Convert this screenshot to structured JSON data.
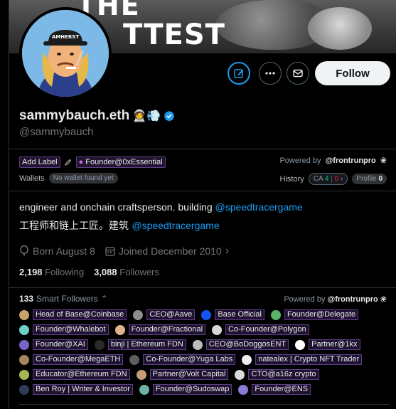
{
  "banner": {
    "text_line1": "THE",
    "text_line2": "TTEST",
    "text_line3": ""
  },
  "profile": {
    "display_name": "sammybauch.eth",
    "name_emojis": "🧑‍🚀💨",
    "handle": "@sammybauch",
    "verified": true,
    "avatar_cap_text": "AMHERST"
  },
  "actions": {
    "edit_icon": "note-edit-icon",
    "more_icon": "ellipsis-icon",
    "message_icon": "envelope-icon",
    "follow_label": "Follow"
  },
  "labels": {
    "add_label": "Add Label",
    "pencil_icon": "pencil-icon",
    "tag": "Founder@0xEssential",
    "powered_by_prefix": "Powered by",
    "powered_by_brand": "@frontrunpro",
    "wallets_label": "Wallets",
    "wallets_value": "No wallet found yet",
    "history_label": "History",
    "ca_label": "CA",
    "ca_green": "4",
    "ca_red": "0",
    "profile_label": "Profile",
    "profile_count": "0"
  },
  "bio": {
    "line1_text": "engineer and onchain craftsperson. building ",
    "line1_link": "@speedtracergame",
    "line2_text": "工程师和链上工匠。建筑 ",
    "line2_link": "@speedtracergame"
  },
  "meta": {
    "born": "Born August 8",
    "joined": "Joined December 2010"
  },
  "stats": {
    "following_count": "2,198",
    "following_label": "Following",
    "followers_count": "3,088",
    "followers_label": "Followers"
  },
  "smart_followers": {
    "count": "133",
    "label": "Smart Followers",
    "powered_by_prefix": "Powered by",
    "powered_by_brand": "@frontrunpro",
    "rows": [
      [
        {
          "label": "Head of Base@Coinbase",
          "color": "#c9a46b"
        },
        {
          "label": "CEO@Aave",
          "color": "#8e8e8e"
        },
        {
          "label": "Base Official",
          "color": "#1652f0"
        },
        {
          "label": "Founder@Delegate",
          "color": "#5ab56a"
        }
      ],
      [
        {
          "label": "Founder@Whalebot",
          "color": "#6fd0c8"
        },
        {
          "label": "Founder@Fractional",
          "color": "#e0b38a"
        },
        {
          "label": "Co-Founder@Polygon",
          "color": "#d8d8d8"
        }
      ],
      [
        {
          "label": "Founder@XAI",
          "color": "#7a63c8"
        },
        {
          "label": "binji | Ethereum FDN",
          "color": "#2a2a2a"
        },
        {
          "label": "CEO@BoDoggosENT",
          "color": "#bcbcbc"
        },
        {
          "label": "Partner@1kx",
          "color": "#ffffff"
        }
      ],
      [
        {
          "label": "Co-Founder@MegaETH",
          "color": "#a3865f"
        },
        {
          "label": "Co-Founder@Yuga Labs",
          "color": "#5e5e5e"
        },
        {
          "label": "natealex | Crypto NFT Trader",
          "color": "#eeeeee"
        }
      ],
      [
        {
          "label": "Educator@Ethereum FDN",
          "color": "#a4b85a"
        },
        {
          "label": "Partner@Volt Capital",
          "color": "#c79a7a"
        },
        {
          "label": "CTO@a16z crypto",
          "color": "#dadada"
        }
      ],
      [
        {
          "label": "Ben Roy | Writer & Investor",
          "color": "#2f3a55"
        },
        {
          "label": "Founder@Sudoswap",
          "color": "#6fb2a3"
        },
        {
          "label": "Founder@ENS",
          "color": "#8a7bd6"
        }
      ]
    ]
  }
}
